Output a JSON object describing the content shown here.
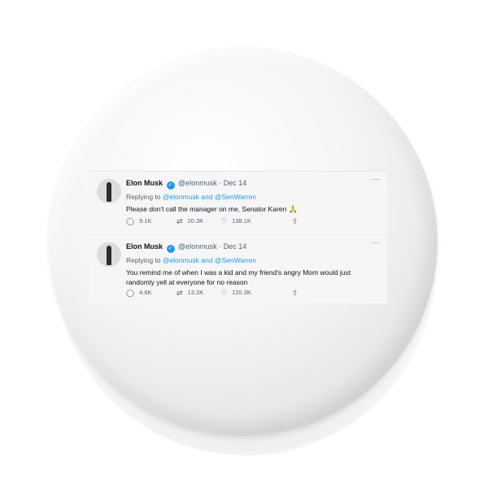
{
  "tweets": [
    {
      "name": "Elon Musk",
      "handle": "@elonmusk",
      "date": "· Dec 14",
      "more": "···",
      "replying_prefix": "Replying to",
      "replying_to": "@elonmusk and @SenWarren",
      "text": "Please don't call the manager on me, Senator Karen",
      "emoji": "🙏",
      "replies": "9.1K",
      "retweets": "20.3K",
      "likes": "138.1K"
    },
    {
      "name": "Elon Musk",
      "handle": "@elonmusk",
      "date": "· Dec 14",
      "more": "···",
      "replying_prefix": "Replying to",
      "replying_to": "@elonmusk and @SenWarren",
      "text": "You remind me of when I was a kid and my friend's angry Mom would just randomly yell at everyone for no reason",
      "replies": "4.6K",
      "retweets": "13.2K",
      "likes": "120.3K"
    }
  ],
  "icons": {
    "verified": "✓",
    "reply": "◯",
    "retweet": "⇄",
    "like": "♡",
    "share": "⇧"
  },
  "colors": {
    "twitter_blue": "#1d9bf0",
    "secondary_text": "#536471"
  }
}
